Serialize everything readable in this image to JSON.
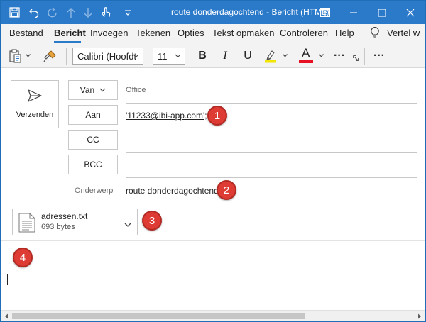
{
  "window": {
    "title": "route donderdagochtend  -  Bericht (HTML)"
  },
  "menu": {
    "tabs": [
      {
        "label": "Bestand",
        "active": false
      },
      {
        "label": "Bericht",
        "active": true
      },
      {
        "label": "Invoegen",
        "active": false
      },
      {
        "label": "Tekenen",
        "active": false
      },
      {
        "label": "Opties",
        "active": false
      },
      {
        "label": "Tekst opmaken",
        "active": false
      },
      {
        "label": "Controleren",
        "active": false
      },
      {
        "label": "Help",
        "active": false
      }
    ],
    "tell_me": "Vertel w"
  },
  "ribbon": {
    "font_name": "Calibri (Hoofdtekst)",
    "font_size": "11",
    "bold": "B",
    "italic": "I",
    "underline": "U",
    "font_color_letter": "A",
    "highlight_color": "#f2e600",
    "font_color": "#e81123",
    "more": "···"
  },
  "compose": {
    "send_label": "Verzenden",
    "from_button": "Van",
    "from_value": "Office",
    "to_button": "Aan",
    "to_value": "'11233@ibi-app.com';",
    "cc_button": "CC",
    "bcc_button": "BCC",
    "subject_label": "Onderwerp",
    "subject_value": "route donderdagochtend",
    "attachment": {
      "name": "adressen.txt",
      "size": "693 bytes"
    },
    "markers": [
      "1",
      "2",
      "3",
      "4"
    ]
  },
  "colors": {
    "titlebar": "#2b79c9",
    "accent": "#2b79c9",
    "marker": "#dd3b33"
  }
}
